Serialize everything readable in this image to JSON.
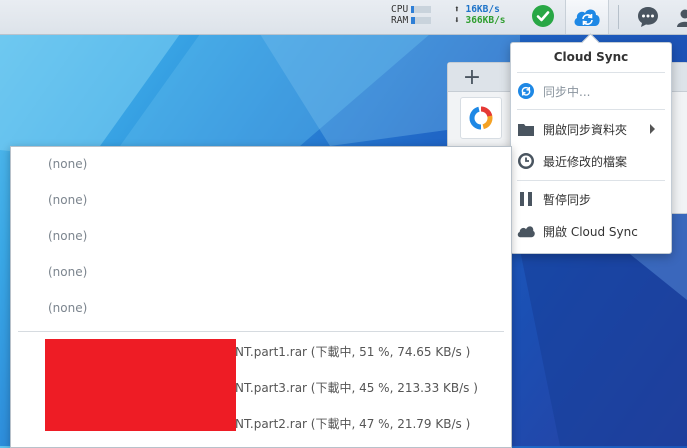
{
  "taskbar": {
    "resource_monitor": {
      "cpu_label": "CPU",
      "ram_label": "RAM",
      "cpu_fill": 0.15,
      "ram_fill": 0.2
    },
    "network": {
      "upload": "16KB/s",
      "download": "366KB/s"
    },
    "icons": {
      "status": "check-circle-icon",
      "cloud_sync": "cloud-sync-icon",
      "chat": "chat-icon",
      "user": "user-icon"
    }
  },
  "background_window": {
    "add_tab": "+"
  },
  "cloud_sync_menu": {
    "title": "Cloud Sync",
    "items": [
      {
        "label": "同步中...",
        "icon": "sync-icon",
        "enabled": false
      },
      {
        "label": "開啟同步資料夾",
        "icon": "folder-icon",
        "has_submenu": true
      },
      {
        "label": "最近修改的檔案",
        "icon": "clock-icon"
      },
      {
        "label": "暫停同步",
        "icon": "pause-icon"
      },
      {
        "label": "開啟 Cloud Sync",
        "icon": "cloud-icon"
      }
    ]
  },
  "recent_files": {
    "empty_items": [
      "(none)",
      "(none)",
      "(none)",
      "(none)",
      "(none)"
    ],
    "downloads": [
      {
        "name": "NT.part1.rar (下載中, 51 %, 74.65 KB/s )"
      },
      {
        "name": "NT.part3.rar (下載中, 45 %, 213.33 KB/s )"
      },
      {
        "name": "NT.part2.rar (下載中, 47 %, 21.79 KB/s )"
      }
    ]
  },
  "colors": {
    "accent": "#2f7fd6",
    "success": "#28a745",
    "redaction": "#ee1c25"
  }
}
